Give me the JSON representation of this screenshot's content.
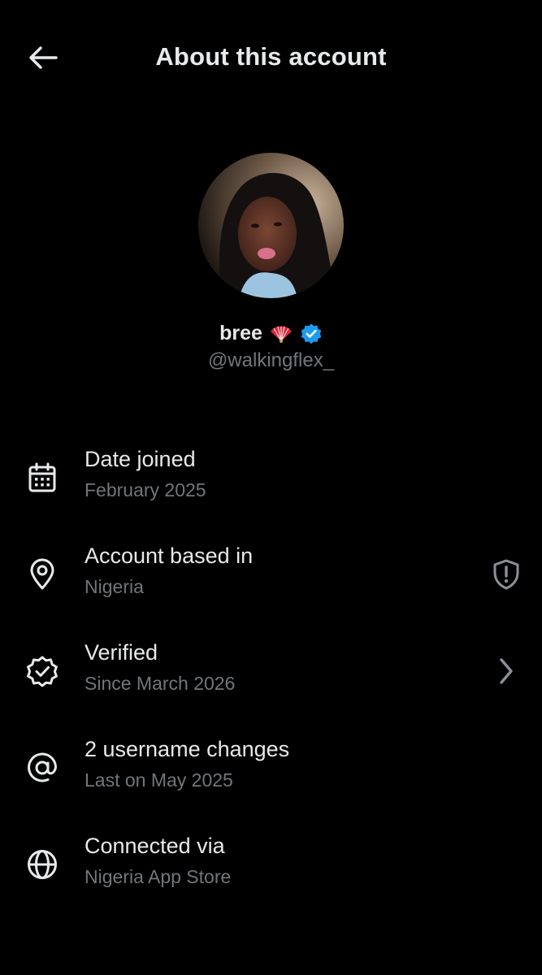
{
  "header": {
    "title": "About this account",
    "back_icon": "arrow-left-icon"
  },
  "profile": {
    "display_name": "bree",
    "emoji": "🪭",
    "verified_icon": "verified-badge-icon",
    "handle": "@walkingflex_"
  },
  "details": [
    {
      "icon": "calendar-icon",
      "label": "Date joined",
      "value": "February 2025",
      "trailing": ""
    },
    {
      "icon": "location-pin-icon",
      "label": "Account based in",
      "value": "Nigeria",
      "trailing": "shield-alert-icon"
    },
    {
      "icon": "verified-check-icon",
      "label": "Verified",
      "value": "Since March 2026",
      "trailing": "chevron-right-icon"
    },
    {
      "icon": "at-sign-icon",
      "label": "2 username changes",
      "value": "Last on May 2025",
      "trailing": ""
    },
    {
      "icon": "globe-icon",
      "label": "Connected via",
      "value": "Nigeria App Store",
      "trailing": ""
    }
  ],
  "colors": {
    "background": "#000000",
    "primary_text": "#e7e9ea",
    "secondary_text": "#71767b",
    "verified_blue": "#1d9bf0"
  }
}
